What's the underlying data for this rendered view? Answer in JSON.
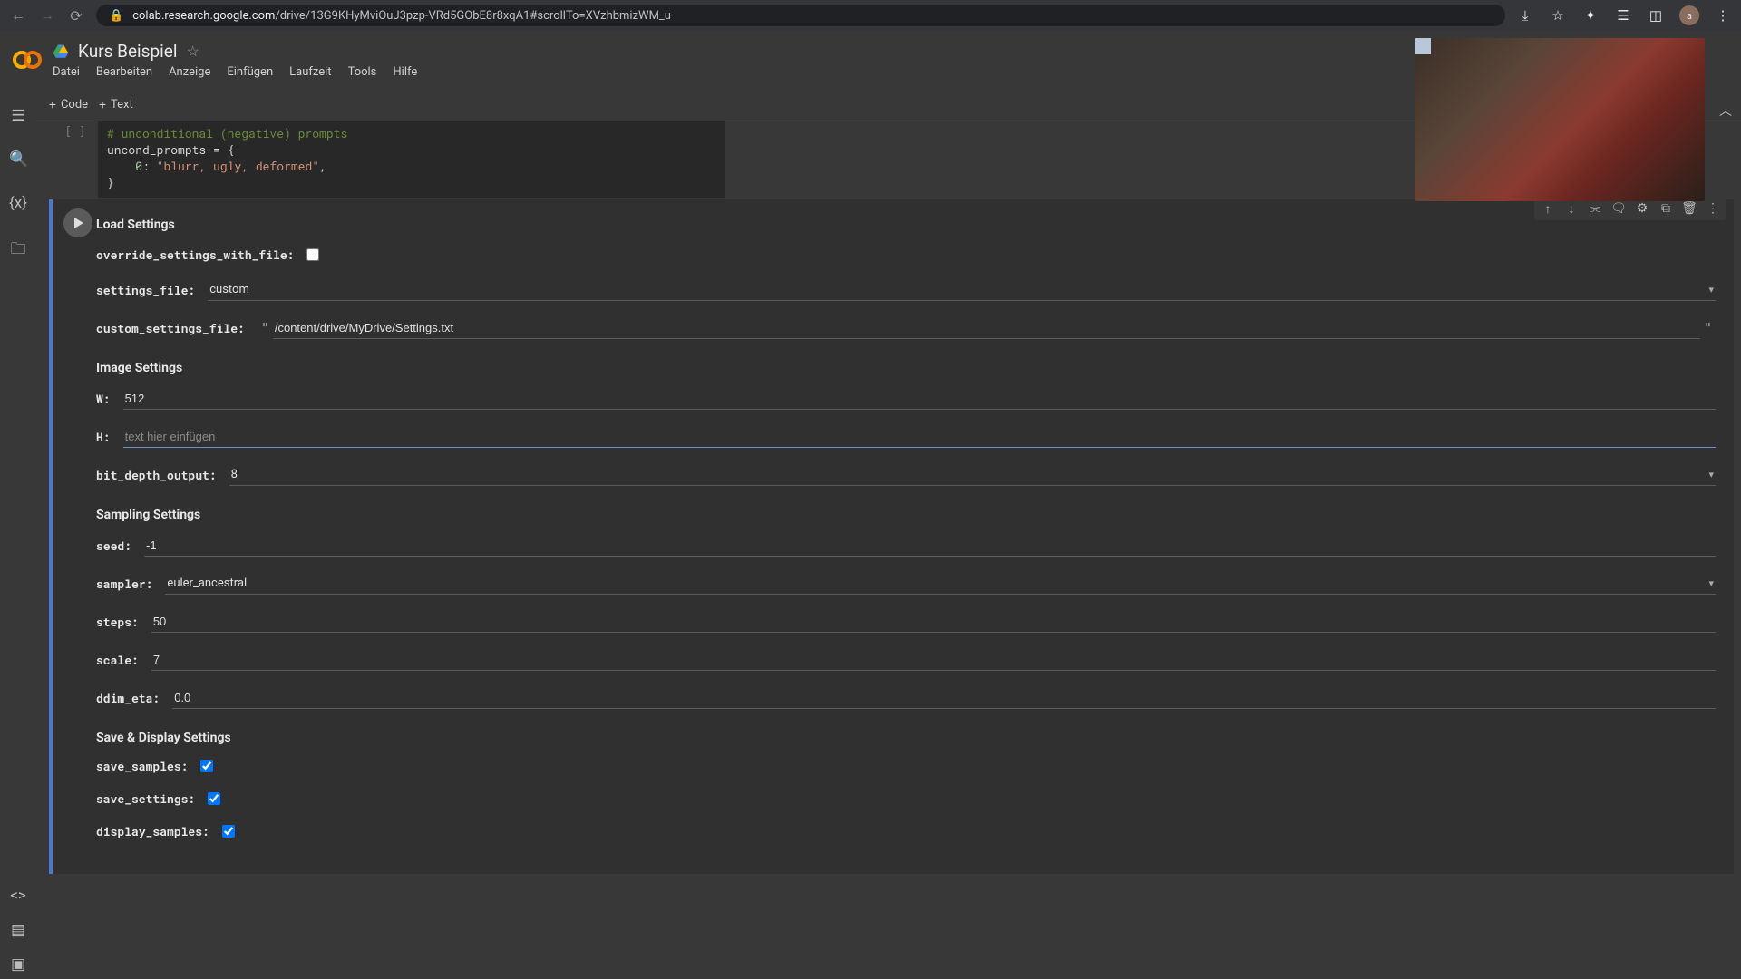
{
  "browser": {
    "url_domain": "colab.research.google.com",
    "url_path": "/drive/13G9KHyMviOuJ3pzp-VRd5GObE8r8xqA1#scrollTo=XVzhbmizWM_u"
  },
  "notebook": {
    "title": "Kurs Beispiel",
    "menu": [
      "Datei",
      "Bearbeiten",
      "Anzeige",
      "Einfügen",
      "Laufzeit",
      "Tools",
      "Hilfe"
    ],
    "add_code": "Code",
    "add_text": "Text"
  },
  "code_cell": {
    "exec_label": "[ ]",
    "line1_comment": "# unconditional (negative) prompts",
    "line2": "uncond_prompts = {",
    "line3_key": "0",
    "line3_sep": ": ",
    "line3_str": "\"blurr, ugly, deformed\"",
    "line3_end": ",",
    "line4": "}"
  },
  "form": {
    "sections": {
      "load": "Load Settings",
      "image": "Image Settings",
      "sampling": "Sampling Settings",
      "save": "Save & Display Settings"
    },
    "labels": {
      "override": "override_settings_with_file:",
      "settings_file": "settings_file:",
      "custom_settings_file": "custom_settings_file:",
      "w": "W:",
      "h": "H:",
      "bit_depth": "bit_depth_output:",
      "seed": "seed:",
      "sampler": "sampler:",
      "steps": "steps:",
      "scale": "scale:",
      "ddim_eta": "ddim_eta:",
      "save_samples": "save_samples:",
      "save_settings": "save_settings:",
      "display_samples": "display_samples:"
    },
    "values": {
      "override": false,
      "settings_file": "custom",
      "custom_settings_file": "/content/drive/MyDrive/Settings.txt",
      "w": "512",
      "h": "",
      "h_placeholder": "text hier einfügen",
      "bit_depth": "8",
      "seed": "-1",
      "sampler": "euler_ancestral",
      "steps": "50",
      "scale": "7",
      "ddim_eta": "0.0",
      "save_samples": true,
      "save_settings": true,
      "display_samples": true
    }
  }
}
